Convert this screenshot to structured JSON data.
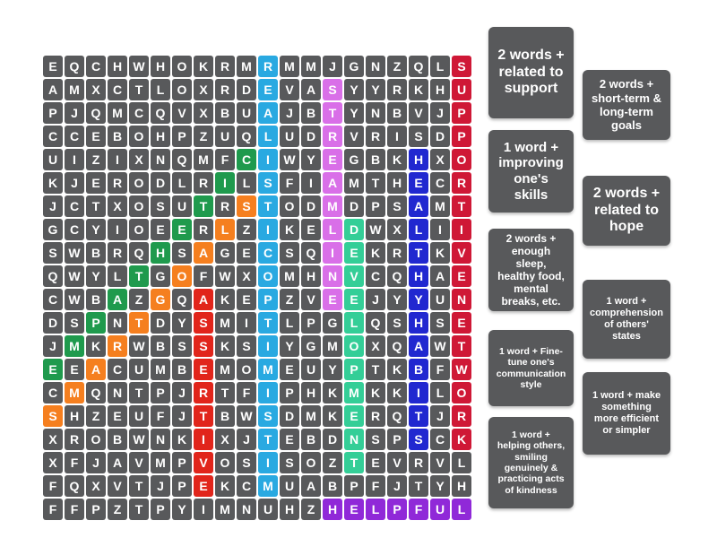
{
  "app": {
    "type": "word-search-puzzle",
    "title": "Word Search"
  },
  "colors": {
    "cell_default": "#58595b",
    "blue": "#29a9e1",
    "navy": "#2128d0",
    "magenta": "#d96fe8",
    "green": "#1f9a4d",
    "teal": "#34ce97",
    "orange": "#f57f1f",
    "red": "#e1251b",
    "crimson": "#cf1836",
    "purple": "#9029d8",
    "card_background": "#58595b",
    "page_background": "#ffffff"
  },
  "grid": {
    "columns": 18,
    "rows": 21,
    "letters": [
      [
        "E",
        "Q",
        "C",
        "H",
        "W",
        "H",
        "O",
        "K",
        "R",
        "M",
        "R",
        "M",
        "M",
        "J",
        "G",
        "N",
        "Z",
        "Q",
        "L",
        "S"
      ],
      [
        "A",
        "M",
        "X",
        "C",
        "T",
        "L",
        "O",
        "X",
        "R",
        "D",
        "E",
        "V",
        "A",
        "S",
        "Y",
        "Y",
        "R",
        "K",
        "H",
        "U"
      ],
      [
        "P",
        "J",
        "Q",
        "M",
        "C",
        "Q",
        "V",
        "X",
        "B",
        "U",
        "A",
        "J",
        "B",
        "T",
        "Y",
        "N",
        "B",
        "V",
        "J",
        "P"
      ],
      [
        "C",
        "C",
        "E",
        "B",
        "O",
        "H",
        "P",
        "Z",
        "U",
        "Q",
        "L",
        "U",
        "D",
        "R",
        "V",
        "R",
        "I",
        "S",
        "D",
        "P"
      ],
      [
        "U",
        "I",
        "Z",
        "I",
        "X",
        "N",
        "Q",
        "M",
        "F",
        "C",
        "I",
        "W",
        "Y",
        "E",
        "G",
        "B",
        "K",
        "H",
        "X",
        "O"
      ],
      [
        "K",
        "J",
        "E",
        "R",
        "O",
        "D",
        "L",
        "R",
        "I",
        "L",
        "S",
        "F",
        "I",
        "A",
        "M",
        "T",
        "H",
        "E",
        "C",
        "R"
      ],
      [
        "J",
        "C",
        "T",
        "X",
        "O",
        "S",
        "U",
        "T",
        "R",
        "S",
        "T",
        "O",
        "D",
        "M",
        "D",
        "P",
        "S",
        "A",
        "M",
        "T"
      ],
      [
        "G",
        "C",
        "Y",
        "I",
        "O",
        "E",
        "E",
        "R",
        "L",
        "Z",
        "I",
        "K",
        "E",
        "L",
        "D",
        "W",
        "X",
        "L",
        "I",
        "I"
      ],
      [
        "S",
        "W",
        "B",
        "R",
        "Q",
        "H",
        "S",
        "A",
        "G",
        "E",
        "C",
        "S",
        "Q",
        "I",
        "E",
        "K",
        "R",
        "T",
        "K",
        "V"
      ],
      [
        "Q",
        "W",
        "Y",
        "L",
        "T",
        "G",
        "O",
        "F",
        "W",
        "X",
        "O",
        "M",
        "H",
        "N",
        "V",
        "C",
        "Q",
        "H",
        "A",
        "E"
      ],
      [
        "C",
        "W",
        "B",
        "A",
        "Z",
        "G",
        "Q",
        "A",
        "K",
        "E",
        "P",
        "Z",
        "V",
        "E",
        "E",
        "J",
        "Y",
        "Y",
        "U",
        "N"
      ],
      [
        "D",
        "S",
        "P",
        "N",
        "T",
        "D",
        "Y",
        "S",
        "M",
        "I",
        "T",
        "L",
        "P",
        "G",
        "L",
        "Q",
        "S",
        "H",
        "S",
        "E"
      ],
      [
        "J",
        "M",
        "K",
        "R",
        "W",
        "B",
        "S",
        "S",
        "K",
        "S",
        "I",
        "Y",
        "G",
        "M",
        "O",
        "X",
        "Q",
        "A",
        "W",
        "T"
      ],
      [
        "E",
        "E",
        "A",
        "C",
        "U",
        "M",
        "B",
        "E",
        "M",
        "O",
        "M",
        "E",
        "U",
        "Y",
        "P",
        "T",
        "K",
        "B",
        "F",
        "W"
      ],
      [
        "C",
        "M",
        "Q",
        "N",
        "T",
        "P",
        "J",
        "R",
        "T",
        "F",
        "I",
        "P",
        "H",
        "K",
        "M",
        "K",
        "K",
        "I",
        "L",
        "O"
      ],
      [
        "S",
        "H",
        "Z",
        "E",
        "U",
        "F",
        "J",
        "T",
        "B",
        "W",
        "S",
        "D",
        "M",
        "K",
        "E",
        "R",
        "Q",
        "T",
        "J",
        "R"
      ],
      [
        "X",
        "R",
        "O",
        "B",
        "W",
        "N",
        "K",
        "I",
        "X",
        "J",
        "T",
        "E",
        "B",
        "D",
        "N",
        "S",
        "P",
        "S",
        "C",
        "K"
      ],
      [
        "X",
        "F",
        "J",
        "A",
        "V",
        "M",
        "P",
        "V",
        "O",
        "S",
        "I",
        "S",
        "O",
        "Z",
        "T",
        "E",
        "V",
        "R",
        "V",
        "L"
      ],
      [
        "F",
        "Q",
        "X",
        "V",
        "T",
        "J",
        "P",
        "E",
        "K",
        "C",
        "M",
        "U",
        "A",
        "B",
        "P",
        "F",
        "J",
        "T",
        "Y",
        "H"
      ],
      [
        "F",
        "F",
        "P",
        "Z",
        "T",
        "P",
        "Y",
        "I",
        "M",
        "N",
        "U",
        "H",
        "Z",
        "H",
        "E",
        "L",
        "P",
        "F",
        "U",
        "L"
      ]
    ],
    "highlights": [
      [
        "",
        "",
        "",
        "",
        "",
        "",
        "",
        "",
        "",
        "",
        "blue",
        "",
        "",
        "",
        "",
        "",
        "",
        "",
        "",
        "crimson"
      ],
      [
        "",
        "",
        "",
        "",
        "",
        "",
        "",
        "",
        "",
        "",
        "blue",
        "",
        "",
        "magenta",
        "",
        "",
        "",
        "",
        "",
        "crimson"
      ],
      [
        "",
        "",
        "",
        "",
        "",
        "",
        "",
        "",
        "",
        "",
        "blue",
        "",
        "",
        "magenta",
        "",
        "",
        "",
        "",
        "",
        "crimson"
      ],
      [
        "",
        "",
        "",
        "",
        "",
        "",
        "",
        "",
        "",
        "",
        "blue",
        "",
        "",
        "magenta",
        "",
        "",
        "",
        "",
        "",
        "crimson"
      ],
      [
        "",
        "",
        "",
        "",
        "",
        "",
        "",
        "",
        "",
        "green",
        "blue",
        "",
        "",
        "magenta",
        "",
        "",
        "",
        "navy",
        "",
        "crimson"
      ],
      [
        "",
        "",
        "",
        "",
        "",
        "",
        "",
        "",
        "green",
        "",
        "blue",
        "",
        "",
        "magenta",
        "",
        "",
        "",
        "navy",
        "",
        "crimson"
      ],
      [
        "",
        "",
        "",
        "",
        "",
        "",
        "",
        "green",
        "",
        "orange",
        "blue",
        "",
        "",
        "magenta",
        "",
        "",
        "",
        "navy",
        "",
        "crimson"
      ],
      [
        "",
        "",
        "",
        "",
        "",
        "",
        "green",
        "",
        "orange",
        "",
        "blue",
        "",
        "",
        "magenta",
        "teal",
        "",
        "",
        "navy",
        "",
        "crimson"
      ],
      [
        "",
        "",
        "",
        "",
        "",
        "green",
        "",
        "orange",
        "",
        "",
        "blue",
        "",
        "",
        "magenta",
        "teal",
        "",
        "",
        "navy",
        "",
        "crimson"
      ],
      [
        "",
        "",
        "",
        "",
        "green",
        "",
        "orange",
        "",
        "",
        "",
        "blue",
        "",
        "",
        "magenta",
        "teal",
        "",
        "",
        "navy",
        "",
        "crimson"
      ],
      [
        "",
        "",
        "",
        "green",
        "",
        "orange",
        "",
        "red",
        "",
        "",
        "blue",
        "",
        "",
        "magenta",
        "teal",
        "",
        "",
        "navy",
        "",
        "crimson"
      ],
      [
        "",
        "",
        "green",
        "",
        "orange",
        "",
        "",
        "red",
        "",
        "",
        "blue",
        "",
        "",
        "",
        "teal",
        "",
        "",
        "navy",
        "",
        "crimson"
      ],
      [
        "",
        "green",
        "",
        "orange",
        "",
        "",
        "",
        "red",
        "",
        "",
        "blue",
        "",
        "",
        "",
        "teal",
        "",
        "",
        "navy",
        "",
        "crimson"
      ],
      [
        "green",
        "",
        "orange",
        "",
        "",
        "",
        "",
        "red",
        "",
        "",
        "blue",
        "",
        "",
        "",
        "teal",
        "",
        "",
        "navy",
        "",
        "crimson"
      ],
      [
        "",
        "orange",
        "",
        "",
        "",
        "",
        "",
        "red",
        "",
        "",
        "blue",
        "",
        "",
        "",
        "teal",
        "",
        "",
        "navy",
        "",
        "crimson"
      ],
      [
        "orange",
        "",
        "",
        "",
        "",
        "",
        "",
        "red",
        "",
        "",
        "blue",
        "",
        "",
        "",
        "teal",
        "",
        "",
        "navy",
        "",
        "crimson"
      ],
      [
        "",
        "",
        "",
        "",
        "",
        "",
        "",
        "red",
        "",
        "",
        "blue",
        "",
        "",
        "",
        "teal",
        "",
        "",
        "navy",
        "",
        "crimson"
      ],
      [
        "",
        "",
        "",
        "",
        "",
        "",
        "",
        "red",
        "",
        "",
        "blue",
        "",
        "",
        "",
        "teal",
        "",
        "",
        "",
        "",
        ""
      ],
      [
        "",
        "",
        "",
        "",
        "",
        "",
        "",
        "red",
        "",
        "",
        "blue",
        "",
        "",
        "",
        "",
        "",
        "",
        "",
        "",
        ""
      ],
      [
        "",
        "",
        "",
        "",
        "",
        "",
        "",
        "",
        "",
        "",
        "",
        "",
        "",
        "purple",
        "purple",
        "purple",
        "purple",
        "purple",
        "purple",
        "purple"
      ]
    ]
  },
  "clues": [
    {
      "id": "clue-support",
      "text": "2 words + related to support"
    },
    {
      "id": "clue-skills",
      "text": "1 word + improving one's skills"
    },
    {
      "id": "clue-selfcare",
      "text": "2 words + enough sleep, healthy food, mental breaks, etc."
    },
    {
      "id": "clue-communication",
      "text": "1 word + Fine-tune one's communication style"
    },
    {
      "id": "clue-kindness",
      "text": "1 word + helping others, smiling genuinely & practicing acts of kindness"
    },
    {
      "id": "clue-goals",
      "text": "2 words + short-term & long-term goals"
    },
    {
      "id": "clue-hope",
      "text": "2 words + related to hope"
    },
    {
      "id": "clue-empathy",
      "text": "1 word + comprehension of others' states"
    },
    {
      "id": "clue-simplify",
      "text": "1 word + make something more efficient or simpler"
    }
  ]
}
